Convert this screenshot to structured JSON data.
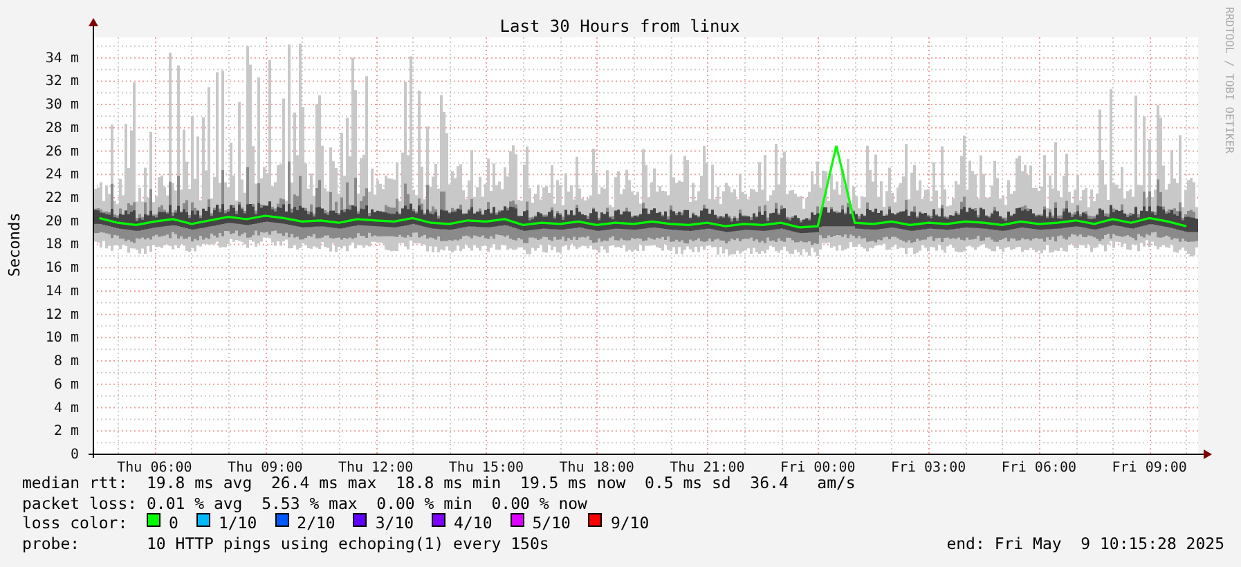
{
  "chart": {
    "side_text": "RRDTOOL / TOBI OETIKER",
    "chart_data": {
      "type": "line",
      "title": "Last 30 Hours from linux",
      "ylabel": "Seconds",
      "categories": [
        null,
        null,
        null,
        "Thu 06:00",
        null,
        null,
        null,
        null,
        null,
        "Thu 09:00",
        null,
        null,
        null,
        null,
        null,
        "Thu 12:00",
        null,
        null,
        null,
        null,
        null,
        "Thu 15:00",
        null,
        null,
        null,
        null,
        null,
        "Thu 18:00",
        null,
        null,
        null,
        null,
        null,
        "Thu 21:00",
        null,
        null,
        null,
        null,
        null,
        "Fri 00:00",
        null,
        null,
        null,
        null,
        null,
        "Fri 03:00",
        null,
        null,
        null,
        null,
        null,
        "Fri 06:00",
        null,
        null,
        null,
        null,
        null,
        "Fri 09:00",
        null,
        null
      ],
      "series": [
        {
          "color": "#00ff00",
          "values": [
            20.2,
            19.8,
            19.6,
            19.9,
            20.1,
            19.7,
            20.0,
            20.3,
            20.1,
            20.4,
            20.2,
            19.9,
            20.0,
            19.8,
            20.1,
            20.0,
            19.9,
            20.2,
            19.8,
            19.7,
            20.0,
            19.9,
            20.1,
            19.6,
            19.8,
            19.7,
            19.9,
            19.6,
            19.8,
            19.7,
            19.9,
            19.7,
            19.6,
            19.8,
            19.5,
            19.7,
            19.6,
            19.8,
            19.4,
            19.5,
            26.4,
            19.8,
            19.7,
            19.9,
            19.6,
            19.8,
            19.7,
            19.9,
            19.8,
            19.6,
            19.9,
            19.7,
            19.8,
            20.0,
            19.7,
            20.1,
            19.8,
            20.2,
            19.9,
            19.5
          ]
        }
      ],
      "ylim": [
        0,
        35.7
      ],
      "grid": true,
      "yticks": [
        {
          "value": 0,
          "label": "0"
        },
        {
          "value": 2,
          "label": "2 m"
        },
        {
          "value": 4,
          "label": "4 m"
        },
        {
          "value": 6,
          "label": "6 m"
        },
        {
          "value": 8,
          "label": "8 m"
        },
        {
          "value": 10,
          "label": "10 m"
        },
        {
          "value": 12,
          "label": "12 m"
        },
        {
          "value": 14,
          "label": "14 m"
        },
        {
          "value": 16,
          "label": "16 m"
        },
        {
          "value": 18,
          "label": "18 m"
        },
        {
          "value": 20,
          "label": "20 m"
        },
        {
          "value": 22,
          "label": "22 m"
        },
        {
          "value": 24,
          "label": "24 m"
        },
        {
          "value": 26,
          "label": "26 m"
        },
        {
          "value": 28,
          "label": "28 m"
        },
        {
          "value": 30,
          "label": "30 m"
        },
        {
          "value": 32,
          "label": "32 m"
        },
        {
          "value": 34,
          "label": "34 m"
        }
      ]
    }
  },
  "legend": {
    "median_rtt": {
      "label": "median rtt:",
      "text": "19.8 ms avg  26.4 ms max  18.8 ms min  19.5 ms now  0.5 ms sd  36.4   am/s"
    },
    "packet_loss": {
      "label": "packet loss:",
      "text": "0.01 % avg  5.53 % max  0.00 % min  0.00 % now"
    },
    "loss_color": {
      "label": "loss color:",
      "items": [
        {
          "label": "0",
          "color": "#00ff00"
        },
        {
          "label": "1/10",
          "color": "#00b8ff"
        },
        {
          "label": "2/10",
          "color": "#0059ff"
        },
        {
          "label": "3/10",
          "color": "#5e00ff"
        },
        {
          "label": "4/10",
          "color": "#7e00ff"
        },
        {
          "label": "5/10",
          "color": "#dd00ff"
        },
        {
          "label": "9/10",
          "color": "#ff0000"
        }
      ]
    },
    "probe": {
      "label": "probe:",
      "text": "10 HTTP pings using echoping(1) every 150s"
    },
    "end": "end: Fri May  9 10:15:28 2025"
  }
}
